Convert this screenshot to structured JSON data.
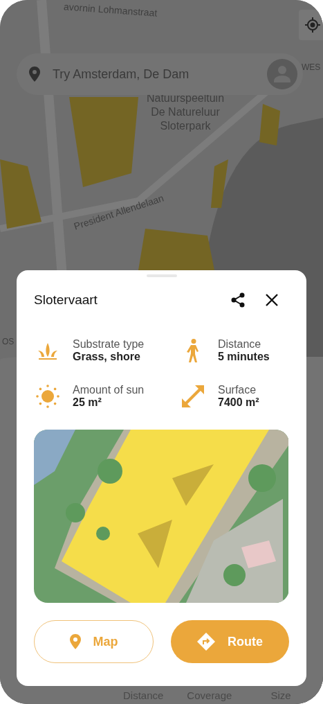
{
  "map": {
    "street_labels": [
      {
        "text": "avornin Lohmanstraat"
      },
      {
        "text": "WES"
      },
      {
        "text": "Natuurspeeltuin De Natureluur Sloterpark"
      },
      {
        "text": "President Allendelaan"
      },
      {
        "text": "OS"
      }
    ]
  },
  "search": {
    "placeholder": "Try Amsterdam, De Dam"
  },
  "background_list": {
    "columns": [
      "Distance",
      "Coverage",
      "Size"
    ]
  },
  "card": {
    "title": "Slotervaart",
    "facts": [
      {
        "kind": "grass",
        "label": "Substrate type",
        "value": "Grass, shore"
      },
      {
        "kind": "walk",
        "label": "Distance",
        "value": "5 minutes"
      },
      {
        "kind": "sun",
        "label": "Amount of sun",
        "value": "25 m²"
      },
      {
        "kind": "surface",
        "label": "Surface",
        "value": "7400 m²"
      }
    ],
    "buttons": [
      {
        "kind": "map",
        "label": "Map"
      },
      {
        "kind": "route",
        "label": "Route"
      }
    ]
  }
}
